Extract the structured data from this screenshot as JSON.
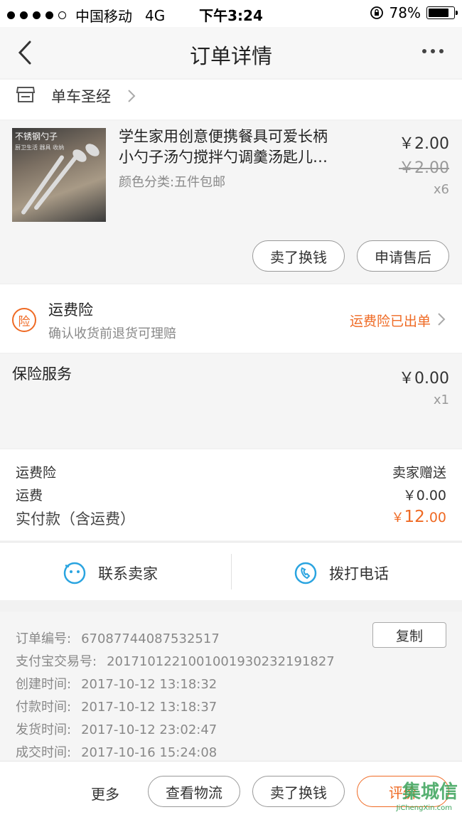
{
  "status_bar": {
    "carrier": "中国移动",
    "network": "4G",
    "time": "下午3:24",
    "battery": "78%",
    "battery_level": 0.78
  },
  "nav": {
    "title": "订单详情"
  },
  "shop": {
    "name": "单车圣经"
  },
  "product": {
    "thumb_tag": "不锈钢勺子",
    "thumb_sub": "厨卫生活 器具 收纳",
    "title_line1": "学生家用创意便携餐具可爱长柄",
    "title_line2": "小勺子汤勺搅拌勺调羹汤匙儿…",
    "variant": "颜色分类:五件包邮",
    "price": "￥2.00",
    "original_price": "￥2.00",
    "quantity": "x6",
    "sell_button": "卖了换钱",
    "aftersale_button": "申请售后"
  },
  "insurance": {
    "icon_text": "险",
    "title": "运费险",
    "subtitle": "确认收货前退货可理赔",
    "status": "运费险已出单"
  },
  "service": {
    "title": "保险服务",
    "price": "￥0.00",
    "quantity": "x1"
  },
  "summary": {
    "freight_insurance_label": "运费险",
    "freight_insurance_value": "卖家赠送",
    "shipping_label": "运费",
    "shipping_value": "￥0.00",
    "paid_label": "实付款（含运费）",
    "paid_currency": "￥",
    "paid_int": "12",
    "paid_dec": ".00"
  },
  "contact": {
    "seller": "联系卖家",
    "call": "拨打电话"
  },
  "order_info": {
    "copy_button": "复制",
    "rows": [
      {
        "label": "订单编号:",
        "value": "67087744087532517"
      },
      {
        "label": "支付宝交易号:",
        "value": "2017101221001001930232191827"
      },
      {
        "label": "创建时间:",
        "value": "2017-10-12 13:18:32"
      },
      {
        "label": "付款时间:",
        "value": "2017-10-12 13:18:37"
      },
      {
        "label": "发货时间:",
        "value": "2017-10-12 23:02:47"
      },
      {
        "label": "成交时间:",
        "value": "2017-10-16 15:24:08"
      }
    ]
  },
  "bottom_bar": {
    "more": "更多",
    "logistics": "查看物流",
    "sell": "卖了换钱",
    "rate": "评价"
  },
  "watermark": {
    "text": "集城信",
    "url": "JiChengXin.com"
  },
  "colors": {
    "accent": "#ef6a24",
    "contact_icon": "#2aa4e0"
  }
}
